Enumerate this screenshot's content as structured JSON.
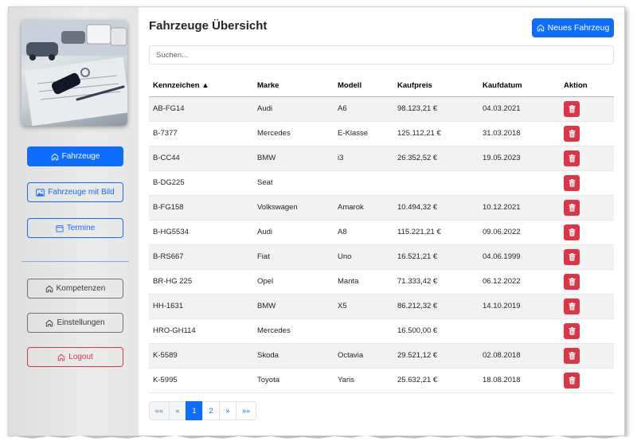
{
  "page": {
    "title": "Fahrzeuge Übersicht",
    "new_button_label": "Neues Fahrzeug",
    "search_placeholder": "Suchen..."
  },
  "sidebar": {
    "items": [
      {
        "label": "Fahrzeuge",
        "icon": "home-icon"
      },
      {
        "label": "Fahrzeuge mit Bild",
        "icon": "image-icon"
      },
      {
        "label": "Termine",
        "icon": "calendar-icon"
      },
      {
        "label": "Kompetenzen",
        "icon": "home-icon"
      },
      {
        "label": "Einstellungen",
        "icon": "home-icon"
      },
      {
        "label": "Logout",
        "icon": "home-icon"
      }
    ]
  },
  "table": {
    "headers": [
      "Kennzeichen ▲",
      "Marke",
      "Modell",
      "Kaufpreis",
      "Kaufdatum",
      "Aktion"
    ],
    "rows": [
      [
        "AB-FG14",
        "Audi",
        "A6",
        "98.123,21 €",
        "04.03.2021"
      ],
      [
        "B-7377",
        "Mercedes",
        "E-Klasse",
        "125.112,21 €",
        "31.03.2018"
      ],
      [
        "B-CC44",
        "BMW",
        "i3",
        "26.352,52 €",
        "19.05.2023"
      ],
      [
        "B-DG225",
        "Seat",
        "",
        "",
        ""
      ],
      [
        "B-FG158",
        "Volkswagen",
        "Amarok",
        "10.494,32 €",
        "10.12.2021"
      ],
      [
        "B-HG5534",
        "Audi",
        "A8",
        "115.221,21 €",
        "09.06.2022"
      ],
      [
        "B-RS667",
        "Fiat",
        "Uno",
        "16.521,21 €",
        "04.06.1999"
      ],
      [
        "BR-HG 225",
        "Opel",
        "Manta",
        "71.333,42 €",
        "06.12.2022"
      ],
      [
        "HH-1631",
        "BMW",
        "X5",
        "86.212,32 €",
        "14.10.2019"
      ],
      [
        "HRO-GH114",
        "Mercedes",
        "",
        "16.500,00 €",
        ""
      ],
      [
        "K-5589",
        "Skoda",
        "Octavia",
        "29.521,12 €",
        "02.08.2018"
      ],
      [
        "K-5995",
        "Toyota",
        "Yaris",
        "25.632,21 €",
        "18.08.2018"
      ]
    ]
  },
  "pagination": {
    "first": "««",
    "prev": "«",
    "pages": [
      "1",
      "2"
    ],
    "active_page": "1",
    "next": "»",
    "last": "»»"
  },
  "colors": {
    "primary": "#0d6efd",
    "danger": "#dc3545",
    "secondary": "#6c757d"
  }
}
